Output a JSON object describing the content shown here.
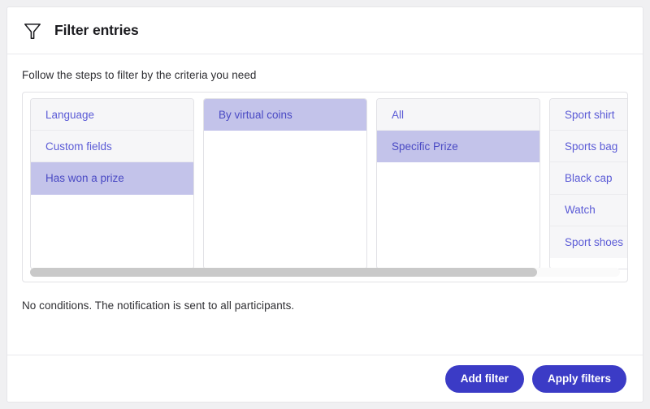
{
  "header": {
    "title": "Filter entries",
    "icon": "funnel-icon"
  },
  "body": {
    "hint": "Follow the steps to filter by the criteria you need",
    "no_conditions": "No conditions. The notification is sent to all participants."
  },
  "colors": {
    "accent": "#3b3bc6",
    "item_text": "#5b5bd6",
    "item_selected_bg": "#c3c3ea",
    "item_bg": "#f6f6f8",
    "scroll_thumb": "#c9c9c9"
  },
  "cascader": {
    "scroll_thumb_percent": 86,
    "columns": [
      {
        "name": "criteria",
        "items": [
          {
            "label": "Language",
            "selected": false
          },
          {
            "label": "Custom fields",
            "selected": false
          },
          {
            "label": "Has won a prize",
            "selected": true
          }
        ]
      },
      {
        "name": "prize-type",
        "items": [
          {
            "label": "By virtual coins",
            "selected": true
          }
        ]
      },
      {
        "name": "prize-scope",
        "items": [
          {
            "label": "All",
            "selected": false
          },
          {
            "label": "Specific Prize",
            "selected": true
          }
        ]
      },
      {
        "name": "prize-list",
        "narrow": true,
        "items": [
          {
            "label": "Sport shirt",
            "selected": false
          },
          {
            "label": "Sports bag",
            "selected": false
          },
          {
            "label": "Black cap",
            "selected": false
          },
          {
            "label": "Watch",
            "selected": false
          },
          {
            "label": "Sport shoes",
            "selected": false
          }
        ]
      }
    ]
  },
  "footer": {
    "add_filter_label": "Add filter",
    "apply_filters_label": "Apply filters"
  }
}
